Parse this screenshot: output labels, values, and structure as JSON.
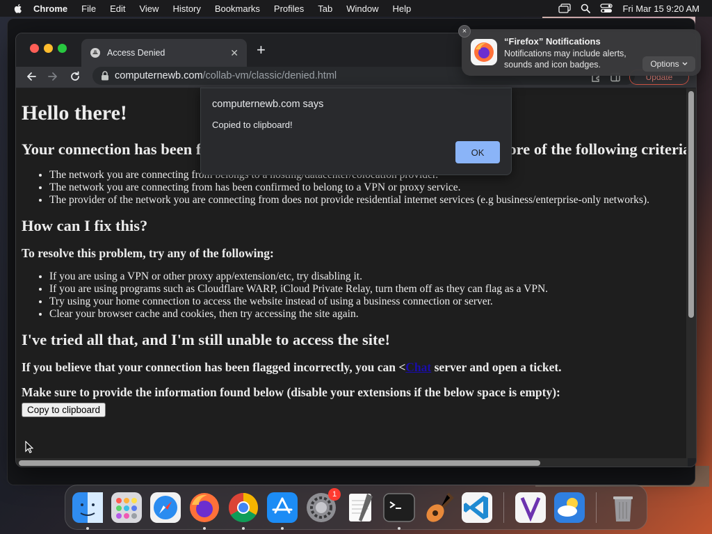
{
  "menubar": {
    "app_name": "Chrome",
    "items": [
      "File",
      "Edit",
      "View",
      "History",
      "Bookmarks",
      "Profiles",
      "Tab",
      "Window",
      "Help"
    ],
    "clock": "Fri Mar 15  9:20 AM"
  },
  "browser": {
    "tab_title": "Access Denied",
    "new_tab_symbol": "+",
    "url_host": "computernewb.com",
    "url_path": "/collab-vm/classic/denied.html",
    "update_label": "Update"
  },
  "page": {
    "heading": "Hello there!",
    "connection_heading": "Your connection has been flagged as suspicious because it meets one or more of the following criteria:",
    "criteria": [
      "The network you are connecting from belongs to a hosting/datacenter/colocation provider.",
      "The network you are connecting from has been confirmed to belong to a VPN or proxy service.",
      "The provider of the network you are connecting from does not provide residential internet services (e.g business/enterprise-only networks)."
    ],
    "fix_heading": "How can I fix this?",
    "resolve_heading": "To resolve this problem, try any of the following:",
    "fixes": [
      "If you are using a VPN or other proxy app/extension/etc, try disabling it.",
      "If you are using programs such as Cloudflare WARP, iCloud Private Relay, turn them off as they can flag as a VPN.",
      "Try using your home connection to access the website instead of using a business connection or server.",
      "Clear your browser cache and cookies, then try accessing the site again."
    ],
    "tried_heading": "I've tried all that, and I'm still unable to access the site!",
    "ticket_before": "If you believe that your connection has been flagged incorrectly, you can <",
    "ticket_link": "Chat",
    "ticket_after": " server and open a ticket.",
    "info_heading": "Make sure to provide the information found below (disable your extensions if the below space is empty):",
    "copy_button": "Copy to clipboard"
  },
  "alert": {
    "title": "computernewb.com says",
    "message": "Copied to clipboard!",
    "ok_label": "OK"
  },
  "notification": {
    "title": "“Firefox” Notifications",
    "body": "Notifications may include alerts, sounds and icon badges.",
    "options_label": "Options",
    "close_symbol": "×"
  },
  "dock": {
    "settings_badge": "1"
  },
  "colors": {
    "alert_ok": "#8ab4f8",
    "link": "#1a0dab",
    "update_outline": "#e25b4a"
  }
}
